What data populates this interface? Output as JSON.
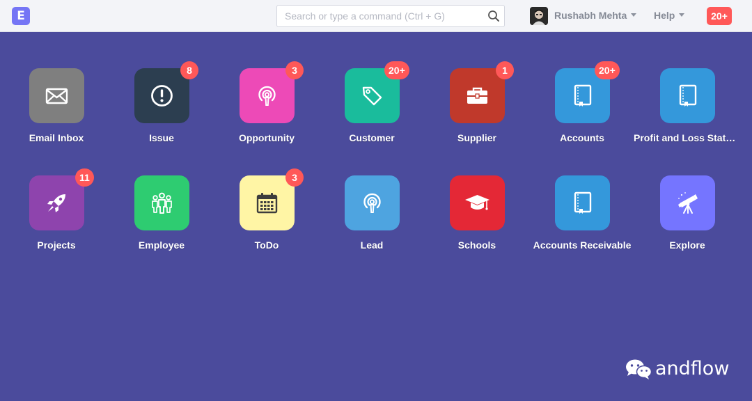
{
  "navbar": {
    "logo": "E",
    "search": {
      "placeholder": "Search or type a command (Ctrl + G)",
      "value": ""
    },
    "user_name": "Rushabh Mehta",
    "help_label": "Help",
    "notifications": "20+"
  },
  "tiles": [
    {
      "label": "Email Inbox",
      "color": "#7f7f7f",
      "icon": "envelope-icon",
      "badge": ""
    },
    {
      "label": "Issue",
      "color": "#2c3e50",
      "icon": "exclamation-circle-icon",
      "badge": "8"
    },
    {
      "label": "Opportunity",
      "color": "#ed4ab7",
      "icon": "broadcast-icon",
      "badge": "3"
    },
    {
      "label": "Customer",
      "color": "#1abc9c",
      "icon": "tag-icon",
      "badge": "20+"
    },
    {
      "label": "Supplier",
      "color": "#c0392b",
      "icon": "briefcase-icon",
      "badge": "1"
    },
    {
      "label": "Accounts",
      "color": "#3498db",
      "icon": "book-icon",
      "badge": "20+"
    },
    {
      "label": "Profit and Loss Statement",
      "color": "#3498db",
      "icon": "book-icon",
      "badge": ""
    },
    {
      "label": "Projects",
      "color": "#8e44ad",
      "icon": "rocket-icon",
      "badge": "11"
    },
    {
      "label": "Employee",
      "color": "#2ecc71",
      "icon": "group-icon",
      "badge": ""
    },
    {
      "label": "ToDo",
      "color": "#fff5a5",
      "icon": "calendar-icon",
      "badge": "3"
    },
    {
      "label": "Lead",
      "color": "#4ea4e0",
      "icon": "broadcast-icon",
      "badge": ""
    },
    {
      "label": "Schools",
      "color": "#e42836",
      "icon": "graduation-cap-icon",
      "badge": ""
    },
    {
      "label": "Accounts Receivable",
      "color": "#3498db",
      "icon": "book-icon",
      "badge": ""
    },
    {
      "label": "Explore",
      "color": "#7575ff",
      "icon": "telescope-icon",
      "badge": ""
    }
  ],
  "watermark": {
    "text": "andflow",
    "icon": "wechat-icon"
  }
}
